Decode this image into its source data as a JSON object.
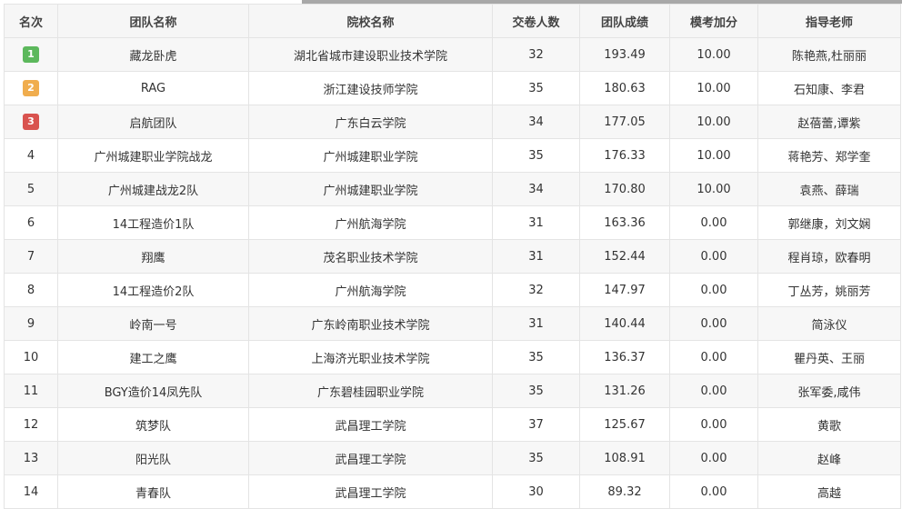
{
  "colors": {
    "rank1": "#5cb85c",
    "rank2": "#f0ad4e",
    "rank3": "#d9534f"
  },
  "table": {
    "headers": [
      "名次",
      "团队名称",
      "院校名称",
      "交卷人数",
      "团队成绩",
      "模考加分",
      "指导老师"
    ],
    "rows": [
      {
        "rank": "1",
        "team": "藏龙卧虎",
        "school": "湖北省城市建设职业技术学院",
        "count": "32",
        "score": "193.49",
        "bonus": "10.00",
        "teacher": "陈艳燕,杜丽丽"
      },
      {
        "rank": "2",
        "team": "RAG",
        "school": "浙江建设技师学院",
        "count": "35",
        "score": "180.63",
        "bonus": "10.00",
        "teacher": "石知康、李君"
      },
      {
        "rank": "3",
        "team": "启航团队",
        "school": "广东白云学院",
        "count": "34",
        "score": "177.05",
        "bonus": "10.00",
        "teacher": "赵蓓蕾,谭紫"
      },
      {
        "rank": "4",
        "team": "广州城建职业学院战龙",
        "school": "广州城建职业学院",
        "count": "35",
        "score": "176.33",
        "bonus": "10.00",
        "teacher": "蒋艳芳、郑学奎"
      },
      {
        "rank": "5",
        "team": "广州城建战龙2队",
        "school": "广州城建职业学院",
        "count": "34",
        "score": "170.80",
        "bonus": "10.00",
        "teacher": "袁燕、薛瑞"
      },
      {
        "rank": "6",
        "team": "14工程造价1队",
        "school": "广州航海学院",
        "count": "31",
        "score": "163.36",
        "bonus": "0.00",
        "teacher": "郭继康，刘文娴"
      },
      {
        "rank": "7",
        "team": "翔鹰",
        "school": "茂名职业技术学院",
        "count": "31",
        "score": "152.44",
        "bonus": "0.00",
        "teacher": "程肖琼，欧春明"
      },
      {
        "rank": "8",
        "team": "14工程造价2队",
        "school": "广州航海学院",
        "count": "32",
        "score": "147.97",
        "bonus": "0.00",
        "teacher": "丁丛芳，姚丽芳"
      },
      {
        "rank": "9",
        "team": "岭南一号",
        "school": "广东岭南职业技术学院",
        "count": "31",
        "score": "140.44",
        "bonus": "0.00",
        "teacher": "简泳仪"
      },
      {
        "rank": "10",
        "team": "建工之鹰",
        "school": "上海济光职业技术学院",
        "count": "35",
        "score": "136.37",
        "bonus": "0.00",
        "teacher": "瞿丹英、王丽"
      },
      {
        "rank": "11",
        "team": "BGY造价14凤先队",
        "school": "广东碧桂园职业学院",
        "count": "35",
        "score": "131.26",
        "bonus": "0.00",
        "teacher": "张军委,咸伟"
      },
      {
        "rank": "12",
        "team": "筑梦队",
        "school": "武昌理工学院",
        "count": "37",
        "score": "125.67",
        "bonus": "0.00",
        "teacher": "黄歌"
      },
      {
        "rank": "13",
        "team": "阳光队",
        "school": "武昌理工学院",
        "count": "35",
        "score": "108.91",
        "bonus": "0.00",
        "teacher": "赵峰"
      },
      {
        "rank": "14",
        "team": "青春队",
        "school": "武昌理工学院",
        "count": "30",
        "score": "89.32",
        "bonus": "0.00",
        "teacher": "高越"
      }
    ]
  }
}
